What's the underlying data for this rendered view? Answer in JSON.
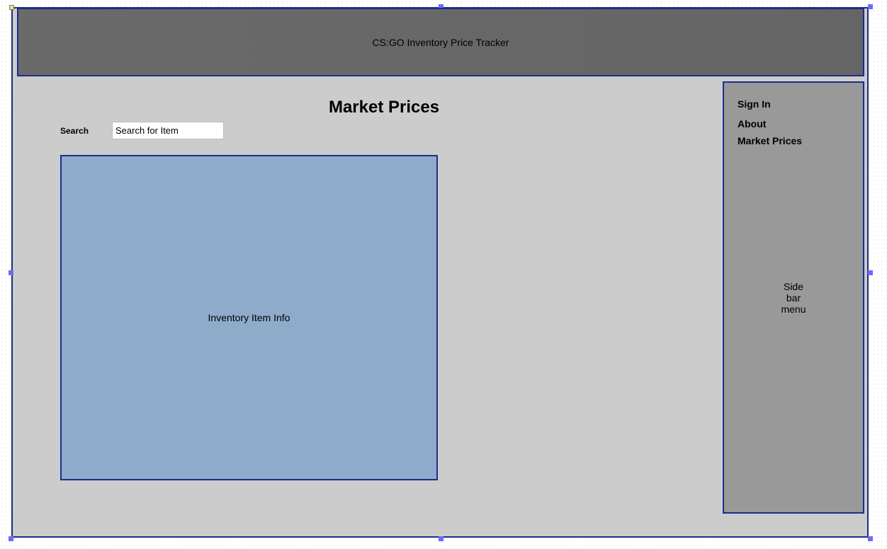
{
  "header": {
    "title": "CS:GO Inventory Price Tracker"
  },
  "main": {
    "page_title": "Market Prices",
    "search_label": "Search",
    "search_placeholder": "Search for Item",
    "inventory_box_label": "Inventory Item Info"
  },
  "sidebar": {
    "items": [
      {
        "label": "Sign In"
      },
      {
        "label": "About"
      },
      {
        "label": "Market Prices"
      }
    ],
    "caption": "Side\nbar\nmenu"
  },
  "colors": {
    "frame_border": "#1c2d8a",
    "header_bg": "#666666",
    "content_bg": "#cccccc",
    "sidebar_bg": "#999999",
    "inventory_bg": "#8eacca",
    "selection_handle": "#6b6bff"
  }
}
